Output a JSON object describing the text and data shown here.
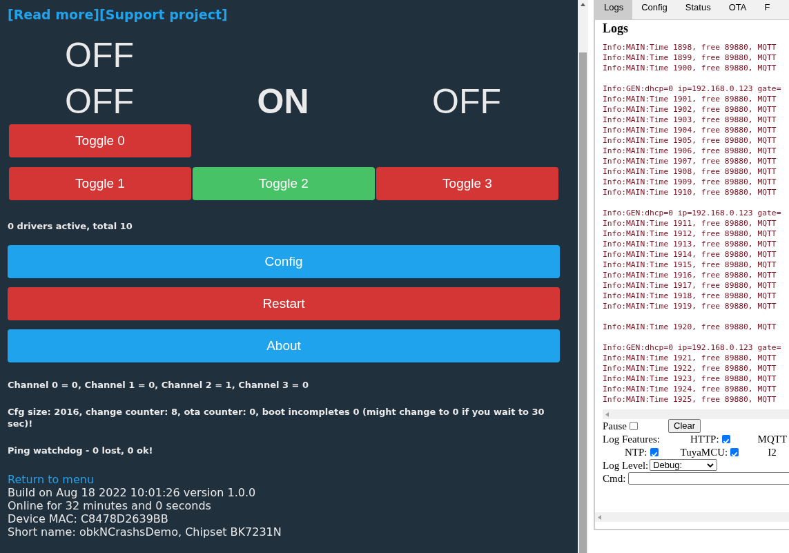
{
  "header_links": [
    "[Read more]",
    "[Support project]"
  ],
  "state_rows": [
    [
      {
        "label": "OFF",
        "on": false
      }
    ],
    [
      {
        "label": "OFF",
        "on": false
      },
      {
        "label": "ON",
        "on": true
      },
      {
        "label": "OFF",
        "on": false
      }
    ]
  ],
  "toggle_rows": [
    [
      {
        "label": "Toggle 0",
        "on": false
      }
    ],
    [
      {
        "label": "Toggle 1",
        "on": false
      },
      {
        "label": "Toggle 2",
        "on": true
      },
      {
        "label": "Toggle 3",
        "on": false
      }
    ]
  ],
  "drivers_text": "0 drivers active, total 10",
  "buttons": [
    {
      "label": "Config",
      "kind": "primary"
    },
    {
      "label": "Restart",
      "kind": "danger"
    },
    {
      "label": "About",
      "kind": "primary"
    }
  ],
  "info_lines": [
    "Channel 0 = 0, Channel 1 = 0, Channel 2 = 1, Channel 3 = 0",
    "Cfg size: 2016, change counter: 8, ota counter: 0, boot incompletes 0 (might change to 0 if you wait to 30 sec)!",
    "Ping watchdog - 0 lost, 0 ok!"
  ],
  "return_link": "Return to menu",
  "footer_lines": [
    "Build on Aug 18 2022 10:01:26 version 1.0.0",
    "Online for 32 minutes and 0 seconds",
    "Device MAC: C8478D2639BB",
    "Short name: obkNCrashsDemo, Chipset BK7231N"
  ],
  "log_panel": {
    "tabs": [
      {
        "label": "Logs",
        "selected": true
      },
      {
        "label": "Config",
        "selected": false
      },
      {
        "label": "Status",
        "selected": false
      },
      {
        "label": "OTA",
        "selected": false
      },
      {
        "label": "F",
        "selected": false
      }
    ],
    "heading": "Logs",
    "log_blocks": [
      [
        "Info:MAIN:Time 1898, free 89880, MQTT",
        "Info:MAIN:Time 1899, free 89880, MQTT",
        "Info:MAIN:Time 1900, free 89880, MQTT"
      ],
      [
        "Info:GEN:dhcp=0 ip=192.168.0.123 gate=",
        "Info:MAIN:Time 1901, free 89880, MQTT",
        "Info:MAIN:Time 1902, free 89880, MQTT",
        "Info:MAIN:Time 1903, free 89880, MQTT",
        "Info:MAIN:Time 1904, free 89880, MQTT",
        "Info:MAIN:Time 1905, free 89880, MQTT",
        "Info:MAIN:Time 1906, free 89880, MQTT",
        "Info:MAIN:Time 1907, free 89880, MQTT",
        "Info:MAIN:Time 1908, free 89880, MQTT",
        "Info:MAIN:Time 1909, free 89880, MQTT",
        "Info:MAIN:Time 1910, free 89880, MQTT"
      ],
      [
        "Info:GEN:dhcp=0 ip=192.168.0.123 gate=",
        "Info:MAIN:Time 1911, free 89880, MQTT",
        "Info:MAIN:Time 1912, free 89880, MQTT",
        "Info:MAIN:Time 1913, free 89880, MQTT",
        "Info:MAIN:Time 1914, free 89880, MQTT",
        "Info:MAIN:Time 1915, free 89880, MQTT",
        "Info:MAIN:Time 1916, free 89880, MQTT",
        "Info:MAIN:Time 1917, free 89880, MQTT",
        "Info:MAIN:Time 1918, free 89880, MQTT",
        "Info:MAIN:Time 1919, free 89880, MQTT"
      ],
      [
        "Info:MAIN:Time 1920, free 89880, MQTT"
      ],
      [
        "Info:GEN:dhcp=0 ip=192.168.0.123 gate=",
        "Info:MAIN:Time 1921, free 89880, MQTT",
        "Info:MAIN:Time 1922, free 89880, MQTT",
        "Info:MAIN:Time 1923, free 89880, MQTT",
        "Info:MAIN:Time 1924, free 89880, MQTT",
        "Info:MAIN:Time 1925, free 89880, MQTT"
      ]
    ],
    "pause": {
      "label": "Pause",
      "checked": false
    },
    "clear_button": "Clear",
    "features_label": "Log Features:",
    "feature_rows": [
      {
        "items": [
          {
            "label": "HTTP:",
            "checked": true
          }
        ],
        "clipped_label": "MQTT"
      },
      {
        "items": [
          {
            "label": "NTP:",
            "checked": true
          },
          {
            "label": "TuyaMCU:",
            "checked": true
          }
        ],
        "clipped_label": "I2"
      }
    ],
    "log_level": {
      "label": "Log Level:",
      "value": "Debug:"
    },
    "cmd": {
      "label": "Cmd:"
    }
  }
}
